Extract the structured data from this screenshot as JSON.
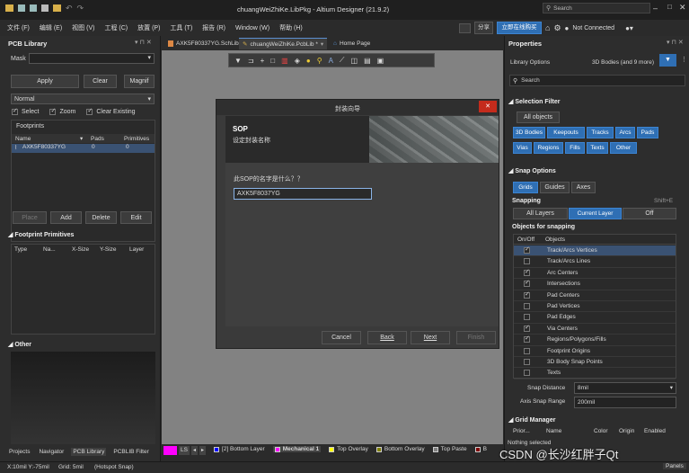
{
  "titlebar": {
    "title": "chuangWeiZhiKe.LibPkg - Altium Designer (21.9.2)",
    "search": "Search",
    "not_connected": "Not Connected",
    "share": "分享",
    "buy": "立即在线购买"
  },
  "menu": [
    "文件 (F)",
    "编辑 (E)",
    "视图 (V)",
    "工程 (C)",
    "放置 (P)",
    "工具 (T)",
    "报告 (R)",
    "Window (W)",
    "帮助 (H)"
  ],
  "left": {
    "title": "PCB Library",
    "mask_label": "Mask",
    "mask_value": "",
    "apply": "Apply",
    "clear": "Clear",
    "magnify": "Magnif",
    "filter_mode": "Normal",
    "select": "Select",
    "zoom": "Zoom",
    "clear_existing": "Clear Existing",
    "footprints_label": "Footprints",
    "cols": [
      "Name",
      "Pads",
      "Primitives"
    ],
    "row": {
      "name": "AXK5F80337YG",
      "pads": "0",
      "prims": "0"
    },
    "place": "Place",
    "add": "Add",
    "delete": "Delete",
    "edit": "Edit",
    "prim_title": "Footprint Primitives",
    "prim_cols": [
      "Type",
      "Na...",
      "X-Size",
      "Y-Size",
      "Layer"
    ],
    "other_title": "Other",
    "bottom_tabs": [
      "Projects",
      "Navigator",
      "PCB Library",
      "PCBLIB Filter"
    ]
  },
  "tabs": [
    "AXK5F80337YG.SchLib",
    "chuangWeiZhiKe.PcbLib *",
    "Home Page"
  ],
  "dialog": {
    "title": "封装向导",
    "heading": "SOP",
    "subtitle": "设定封装名称",
    "question": "此SOP的名字是什么？？",
    "value": "AXK5F8037YG",
    "cancel": "Cancel",
    "back": "Back",
    "next": "Next",
    "finish": "Finish"
  },
  "layers": {
    "ls": "LS",
    "items": [
      {
        "name": "[2] Bottom Layer",
        "color": "#0000ff"
      },
      {
        "name": "Mechanical 1",
        "color": "#ff00ff"
      },
      {
        "name": "Top Overlay",
        "color": "#ffff00"
      },
      {
        "name": "Bottom Overlay",
        "color": "#808000"
      },
      {
        "name": "Top Paste",
        "color": "#808080"
      },
      {
        "name": "B",
        "color": "#800000"
      }
    ]
  },
  "status": {
    "coords": "X:10mil Y:-75mil",
    "grid": "Grid: 5mil",
    "snap": "(Hotspot Snap)",
    "panels": "Panels"
  },
  "props": {
    "title": "Properties",
    "library_options": "Library Options",
    "bodies": "3D Bodies (and 9 more)",
    "search": "Search",
    "sel_filter": "Selection Filter",
    "all_objects": "All objects",
    "filters": [
      "3D Bodies",
      "Keepouts",
      "Tracks",
      "Arcs",
      "Pads",
      "Vias",
      "Regions",
      "Fills",
      "Texts",
      "Other"
    ],
    "snap_options": "Snap Options",
    "grids": "Grids",
    "guides": "Guides",
    "axes": "Axes",
    "snapping": "Snapping",
    "shortcut": "Shift+E",
    "all_layers": "All Layers",
    "current_layer": "Current Layer",
    "off": "Off",
    "objects_for_snapping": "Objects for snapping",
    "onoff": "On/Off",
    "objects": "Objects",
    "snap_items": [
      {
        "name": "Track/Arcs Vertices",
        "on": true
      },
      {
        "name": "Track/Arcs Lines",
        "on": false
      },
      {
        "name": "Arc Centers",
        "on": true
      },
      {
        "name": "Intersections",
        "on": true
      },
      {
        "name": "Pad Centers",
        "on": true
      },
      {
        "name": "Pad Vertices",
        "on": false
      },
      {
        "name": "Pad Edges",
        "on": false
      },
      {
        "name": "Via Centers",
        "on": true
      },
      {
        "name": "Regions/Polygons/Fills",
        "on": true
      },
      {
        "name": "Footprint Origins",
        "on": false
      },
      {
        "name": "3D Body Snap Points",
        "on": false
      },
      {
        "name": "Texts",
        "on": false
      }
    ],
    "snap_distance_label": "Snap Distance",
    "snap_distance": "8mil",
    "axis_snap_label": "Axis Snap Range",
    "axis_snap": "200mil",
    "grid_manager": "Grid Manager",
    "gm_cols": [
      "Prior...",
      "Name",
      "Color",
      "Origin",
      "Enabled"
    ],
    "nothing_selected": "Nothing selected",
    "watermark": "CSDN @长沙红胖子Qt"
  }
}
